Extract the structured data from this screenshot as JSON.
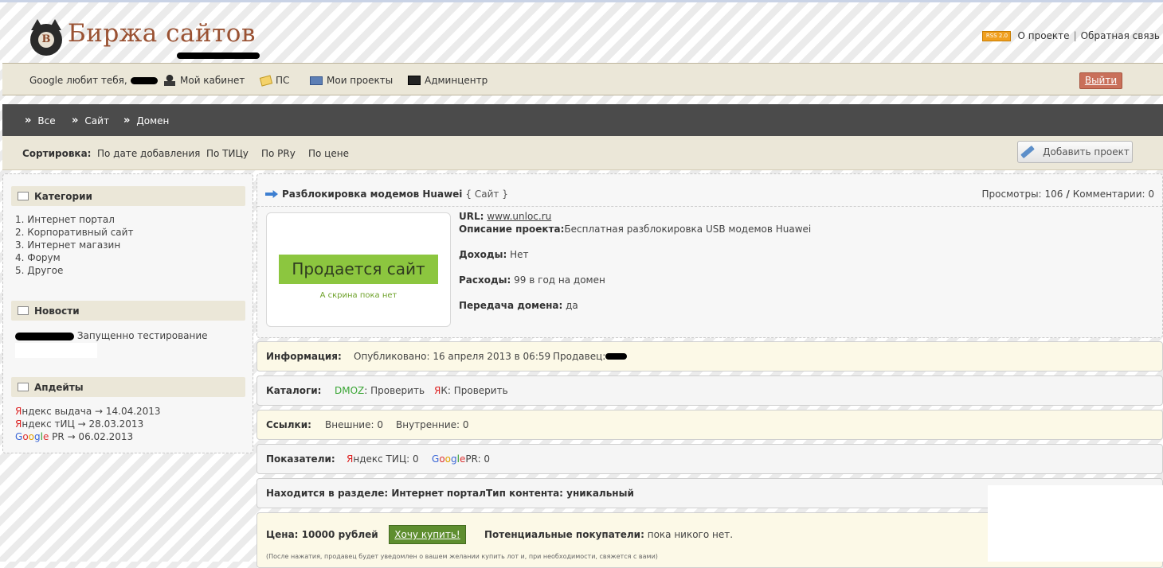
{
  "header": {
    "logo_letter": "B",
    "logo_text": "Биржа сайтов",
    "rss": "RSS 2.0",
    "about": "О проекте",
    "separator": "|",
    "feedback": "Обратная связь"
  },
  "userbar": {
    "greeting": "Google любит тебя,",
    "cabinet": "Мой кабинет",
    "ps": "ПС",
    "projects": "Мои проекты",
    "admin": "Админцентр",
    "logout": "Выйти"
  },
  "nav": {
    "chevron": "»",
    "items": [
      "Все",
      "Сайт",
      "Домен"
    ]
  },
  "sortbar": {
    "label": "Сортировка:",
    "options": [
      "По дате добавления",
      "По ТИЦу",
      "По PRу",
      "По цене"
    ],
    "add_project": "Добавить проект"
  },
  "sidebar": {
    "categories_title": "Категории",
    "categories": [
      "1.  Интернет портал",
      "2.  Корпоративный сайт",
      "3.  Интернет магазин",
      "4.  Форум",
      "5.  Другое"
    ],
    "news_title": "Новости",
    "news_text": "Запущенно тестирование проекта",
    "updates_title": "Апдейты",
    "updates": {
      "y1_first": "Я",
      "y1_rest": "ндекс выдача → 14.04.2013",
      "y2_first": "Я",
      "y2_rest": "ндекс тИЦ → 28.03.2013",
      "g_G": "G",
      "g_o1": "o",
      "g_o2": "o",
      "g_g": "g",
      "g_l": "l",
      "g_e": "e",
      "g_rest": " PR → 06.02.2013"
    }
  },
  "project": {
    "title": "Разблокировка модемов Huawei",
    "kind": "{ Сайт }",
    "views_label": "Просмотры:",
    "views": "106",
    "slash": "/",
    "comments_label": "Комментарии:",
    "comments": "0",
    "screenshot_button": "Продается сайт",
    "screenshot_caption": "А скрина пока нет",
    "url_label": "URL:",
    "url": "www.unloc.ru",
    "desc_label": "Описание проекта:",
    "desc": "Бесплатная разблокировка USB модемов Huawei",
    "income_label": "Доходы:",
    "income": "Нет",
    "expenses_label": "Расходы:",
    "expenses": "99 в год на домен",
    "transfer_label": "Передача домена:",
    "transfer": "да"
  },
  "info": {
    "label": "Информация:",
    "published": "Опубликовано: 16 апреля 2013 в 06:59",
    "seller_label": "Продавец:"
  },
  "catalogs": {
    "label": "Каталоги:",
    "dmoz": "DMOZ",
    "dmoz_rest": ": Проверить",
    "yak_first": "Я",
    "yak_rest": "К: Проверить"
  },
  "links": {
    "label": "Ссылки:",
    "external": "Внешние: 0",
    "internal": "Внутренние: 0"
  },
  "metrics": {
    "label": "Показатели:",
    "tic_first": "Я",
    "tic_rest": "ндекс ТИЦ: 0",
    "pr_G": "G",
    "pr_o1": "o",
    "pr_o2": "o",
    "pr_g": "g",
    "pr_l": "l",
    "pr_e": "e",
    "pr_rest": " PR: 0"
  },
  "section": {
    "section_text": "Находится в разделе: Интернет портал",
    "content_text": "Тип контента: уникальный"
  },
  "price": {
    "label": "Цена: 10000 рублей",
    "buy": "Хочу купить!",
    "buyers_label": "Потенциальные покупатели:",
    "buyers": "пока никого нет.",
    "note": "(После нажатия, продавец будет уведомлен о вашем желании купить лот и, при необходимости, свяжется с вами)"
  },
  "colors": {
    "nav_bg": "#4b4b4b",
    "bar_bg": "#ebe7d8",
    "logo": "#9a5233",
    "logout_bg": "#c9705a",
    "buy_bg": "#5e8e2f",
    "screenshot_green": "#8cc63f"
  },
  "icons": [
    "rss-icon",
    "person-icon",
    "note-icon",
    "projects-icon",
    "terminal-icon",
    "pencil-icon",
    "arrow-right-icon",
    "window-icon",
    "chevron-right-icon"
  ]
}
